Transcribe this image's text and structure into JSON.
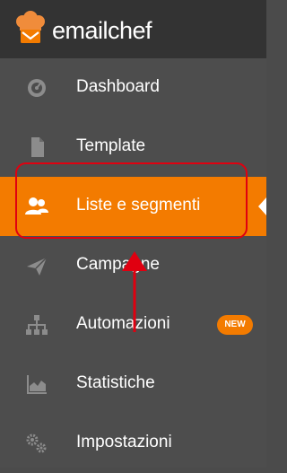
{
  "app": {
    "brand": "emailchef"
  },
  "sidebar": {
    "items": [
      {
        "label": "Dashboard",
        "icon": "dashboard-gauge-icon"
      },
      {
        "label": "Template",
        "icon": "document-icon"
      },
      {
        "label": "Liste e segmenti",
        "icon": "users-icon",
        "active": true
      },
      {
        "label": "Campagne",
        "icon": "paper-plane-icon"
      },
      {
        "label": "Automazioni",
        "icon": "sitemap-icon",
        "badge": "NEW"
      },
      {
        "label": "Statistiche",
        "icon": "area-chart-icon"
      },
      {
        "label": "Impostazioni",
        "icon": "gears-icon"
      }
    ]
  },
  "colors": {
    "accent": "#f37b00",
    "sidebar_bg": "#4d4d4d",
    "topbar_bg": "#333333",
    "icon": "#8c8c8c",
    "annotation": "#e00010"
  }
}
